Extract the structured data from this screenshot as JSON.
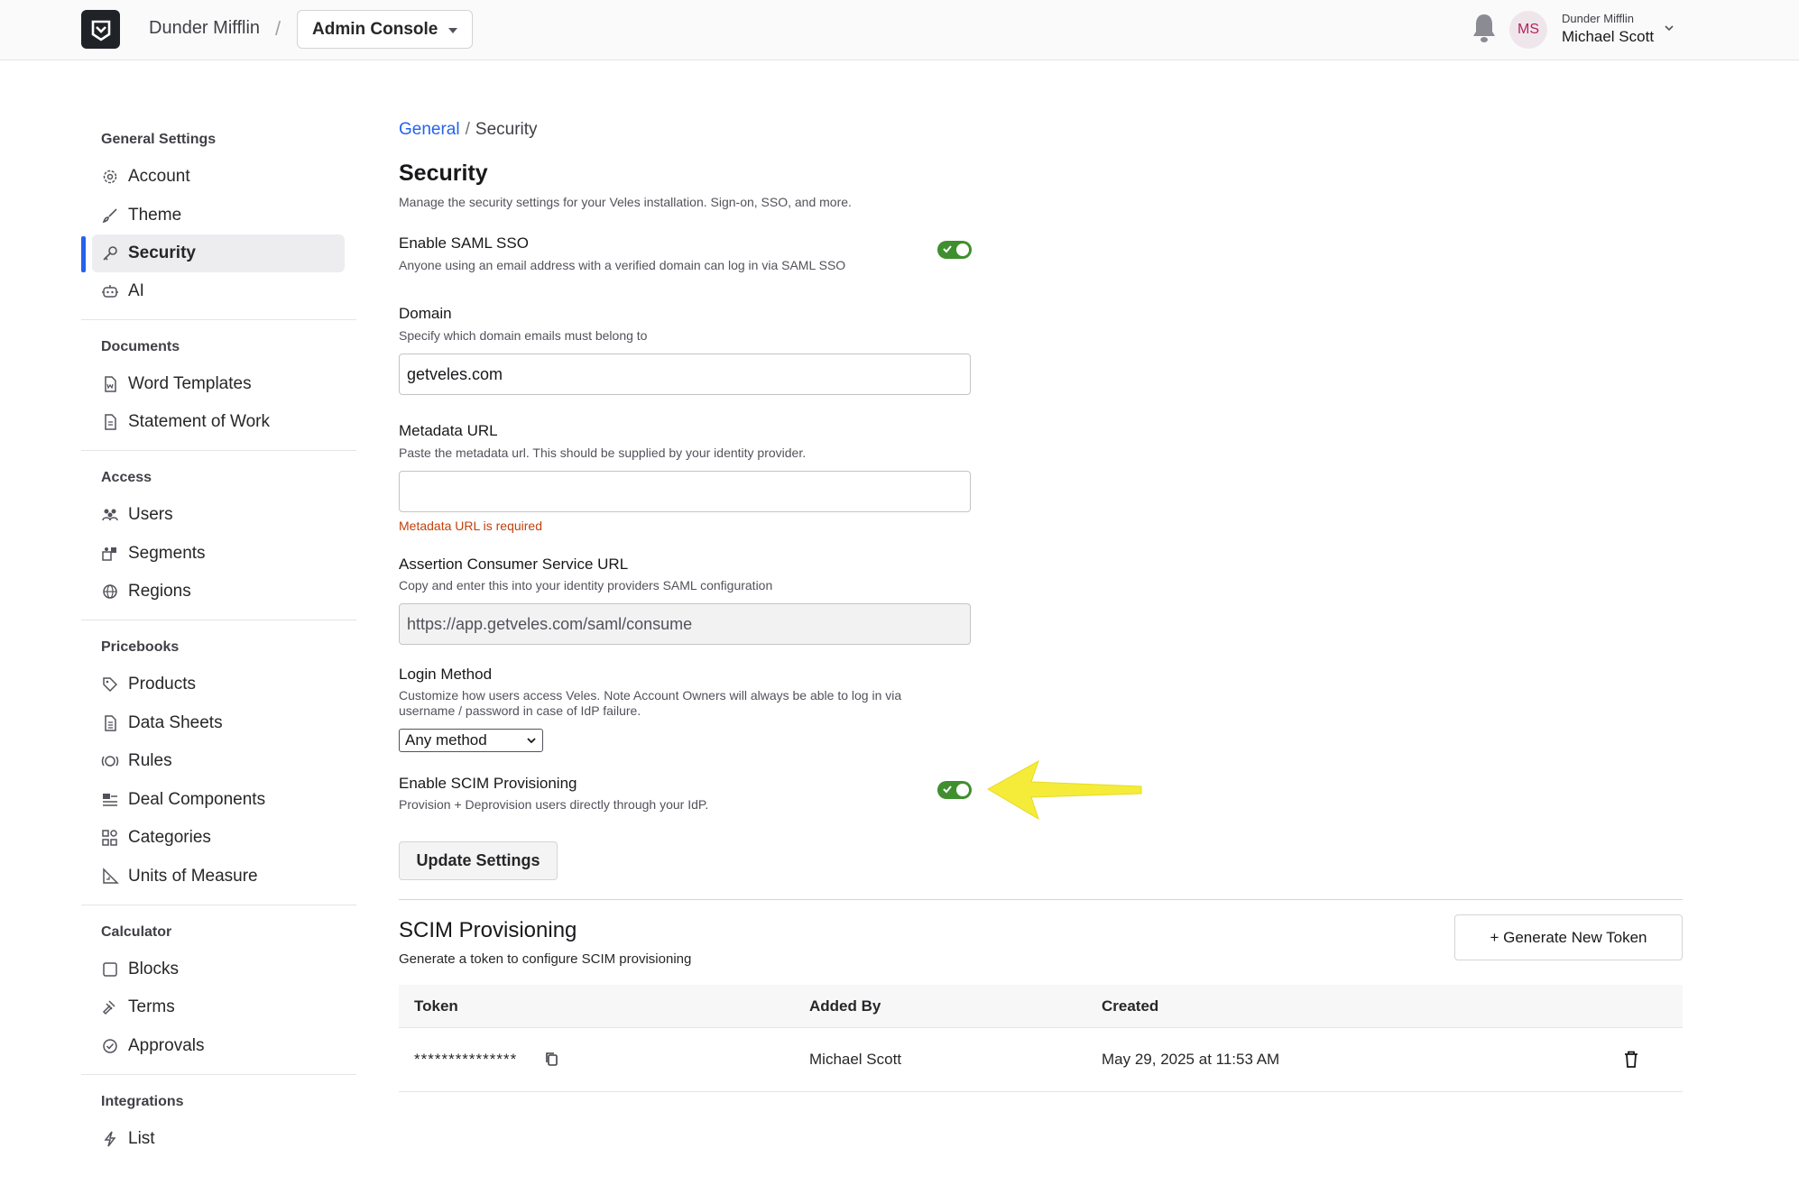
{
  "topbar": {
    "org_name": "Dunder Mifflin",
    "separator": "/",
    "console_label": "Admin Console",
    "user_initials": "MS",
    "user_org": "Dunder Mifflin",
    "user_name": "Michael Scott"
  },
  "sidebar": {
    "sections": [
      {
        "title": "General Settings",
        "items": [
          {
            "label": "Account",
            "icon": "gear-icon"
          },
          {
            "label": "Theme",
            "icon": "brush-icon"
          },
          {
            "label": "Security",
            "icon": "key-icon",
            "active": true
          },
          {
            "label": "AI",
            "icon": "robot-icon"
          }
        ]
      },
      {
        "title": "Documents",
        "items": [
          {
            "label": "Word Templates",
            "icon": "word-doc-icon"
          },
          {
            "label": "Statement of Work",
            "icon": "document-icon"
          }
        ]
      },
      {
        "title": "Access",
        "items": [
          {
            "label": "Users",
            "icon": "users-icon"
          },
          {
            "label": "Segments",
            "icon": "segments-icon"
          },
          {
            "label": "Regions",
            "icon": "globe-icon"
          }
        ]
      },
      {
        "title": "Pricebooks",
        "items": [
          {
            "label": "Products",
            "icon": "tag-icon"
          },
          {
            "label": "Data Sheets",
            "icon": "sheet-icon"
          },
          {
            "label": "Rules",
            "icon": "rules-icon"
          },
          {
            "label": "Deal Components",
            "icon": "components-icon"
          },
          {
            "label": "Categories",
            "icon": "categories-icon"
          },
          {
            "label": "Units of Measure",
            "icon": "ruler-icon"
          }
        ]
      },
      {
        "title": "Calculator",
        "items": [
          {
            "label": "Blocks",
            "icon": "square-icon"
          },
          {
            "label": "Terms",
            "icon": "gavel-icon"
          },
          {
            "label": "Approvals",
            "icon": "check-circle-icon"
          }
        ]
      },
      {
        "title": "Integrations",
        "items": [
          {
            "label": "List",
            "icon": "bolt-icon"
          }
        ]
      }
    ]
  },
  "breadcrumb": {
    "parent": "General",
    "sep": "/",
    "current": "Security"
  },
  "page": {
    "title": "Security",
    "description": "Manage the security settings for your Veles installation. Sign-on, SSO, and more."
  },
  "saml": {
    "label": "Enable SAML SSO",
    "description": "Anyone using an email address with a verified domain can log in via SAML SSO",
    "enabled": true
  },
  "domain": {
    "label": "Domain",
    "description": "Specify which domain emails must belong to",
    "value": "getveles.com"
  },
  "metadata": {
    "label": "Metadata URL",
    "description": "Paste the metadata url. This should be supplied by your identity provider.",
    "value": "",
    "error": "Metadata URL is required"
  },
  "acs": {
    "label": "Assertion Consumer Service URL",
    "description": "Copy and enter this into your identity providers SAML configuration",
    "value": "https://app.getveles.com/saml/consume"
  },
  "login_method": {
    "label": "Login Method",
    "description_line1": "Customize how users access Veles. Note Account Owners will always be able to log in via",
    "description_line2": "username / password in case of IdP failure.",
    "selected": "Any method"
  },
  "scim_toggle": {
    "label": "Enable SCIM Provisioning",
    "description": "Provision + Deprovision users directly through your IdP.",
    "enabled": true
  },
  "update_button": "Update Settings",
  "scim": {
    "title": "SCIM Provisioning",
    "description": "Generate a token to configure SCIM provisioning",
    "generate_button": "+ Generate New Token",
    "columns": [
      "Token",
      "Added By",
      "Created"
    ],
    "rows": [
      {
        "token": "***************",
        "added_by": "Michael Scott",
        "created": "May 29, 2025 at 11:53 AM"
      }
    ]
  },
  "colors": {
    "accent": "#2563eb",
    "toggle_on": "#3f8f2e",
    "error": "#c2410c",
    "annotation_arrow": "#f5ec3a"
  }
}
